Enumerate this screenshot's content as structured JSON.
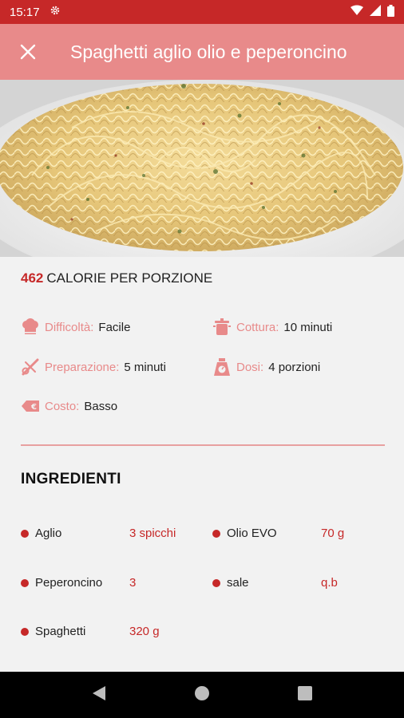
{
  "status_bar": {
    "time": "15:17"
  },
  "app_bar": {
    "title": "Spaghetti aglio olio e peperoncino"
  },
  "calories": {
    "value": "462",
    "label": "CALORIE PER PORZIONE"
  },
  "info": {
    "difficulty": {
      "label": "Difficoltà:",
      "value": "Facile"
    },
    "cooking": {
      "label": "Cottura:",
      "value": "10 minuti"
    },
    "preparation": {
      "label": "Preparazione:",
      "value": "5 minuti"
    },
    "doses": {
      "label": "Dosi:",
      "value": "4 porzioni"
    },
    "cost": {
      "label": "Costo:",
      "value": "Basso"
    }
  },
  "ingredients": {
    "title": "INGREDIENTI",
    "items": [
      {
        "name": "Aglio",
        "qty": "3 spicchi"
      },
      {
        "name": "Olio EVO",
        "qty": "70 g"
      },
      {
        "name": "Peperoncino",
        "qty": "3"
      },
      {
        "name": "sale",
        "qty": "q.b"
      },
      {
        "name": "Spaghetti",
        "qty": "320 g"
      }
    ]
  },
  "colors": {
    "primary": "#c62828",
    "accent": "#e88a8a",
    "background": "#f2f2f2"
  }
}
